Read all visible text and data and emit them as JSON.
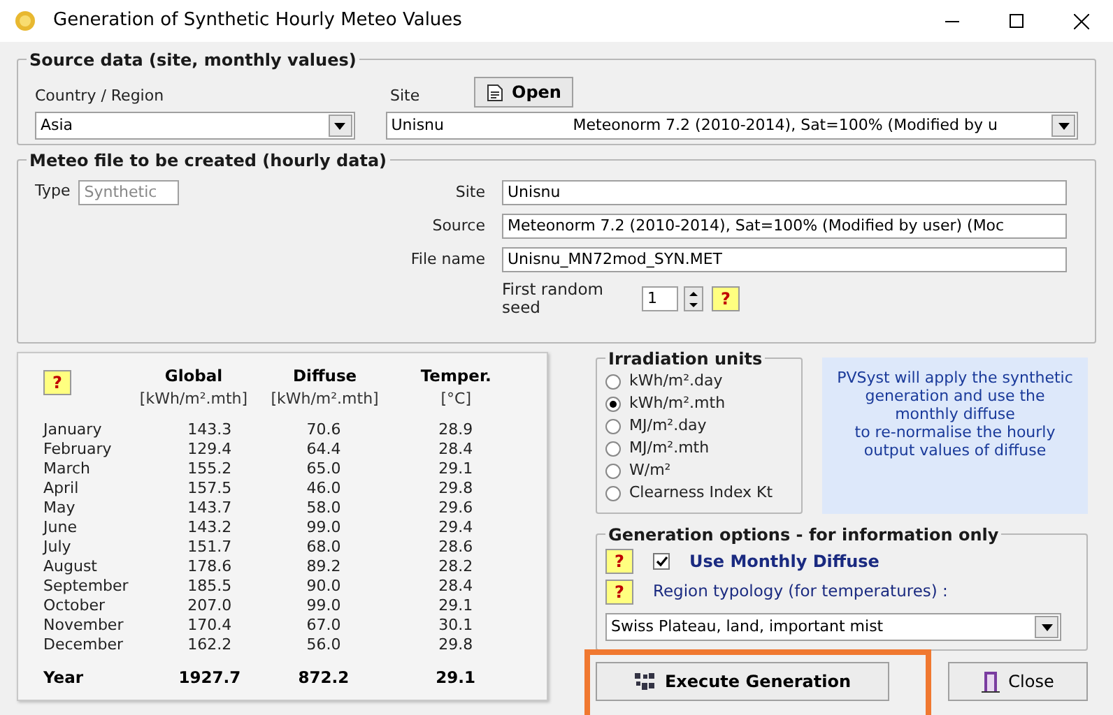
{
  "window": {
    "title": "Generation of Synthetic Hourly Meteo Values"
  },
  "source": {
    "title": "Source data  (site, monthly values)",
    "country_label": "Country / Region",
    "country_value": "Asia",
    "site_label": "Site",
    "open_button": "Open",
    "site_value": "Unisnu",
    "site_source": "Meteonorm 7.2 (2010-2014), Sat=100% (Modified by u"
  },
  "meteo": {
    "title": "Meteo file to be created (hourly data)",
    "type_label": "Type",
    "type_value": "Synthetic",
    "site_label": "Site",
    "site_value": "Unisnu",
    "source_label": "Source",
    "source_value": "Meteonorm 7.2 (2010-2014), Sat=100% (Modified by user) (Moc",
    "filename_label": "File name",
    "filename_value": "Unisnu_MN72mod_SYN.MET",
    "seed_label": "First random seed",
    "seed_value": "1",
    "help": "?"
  },
  "table": {
    "columns": [
      {
        "name": "Global",
        "unit": "[kWh/m².mth]"
      },
      {
        "name": "Diffuse",
        "unit": "[kWh/m².mth]"
      },
      {
        "name": "Temper.",
        "unit": "[°C]"
      }
    ],
    "rows": [
      {
        "month": "January",
        "values": [
          "143.3",
          "70.6",
          "28.9"
        ]
      },
      {
        "month": "February",
        "values": [
          "129.4",
          "64.4",
          "28.4"
        ]
      },
      {
        "month": "March",
        "values": [
          "155.2",
          "65.0",
          "29.1"
        ]
      },
      {
        "month": "April",
        "values": [
          "157.5",
          "46.0",
          "29.8"
        ]
      },
      {
        "month": "May",
        "values": [
          "143.7",
          "58.0",
          "29.6"
        ]
      },
      {
        "month": "June",
        "values": [
          "143.2",
          "99.0",
          "29.4"
        ]
      },
      {
        "month": "July",
        "values": [
          "151.7",
          "68.0",
          "28.6"
        ]
      },
      {
        "month": "August",
        "values": [
          "178.6",
          "89.2",
          "28.2"
        ]
      },
      {
        "month": "September",
        "values": [
          "185.5",
          "90.0",
          "28.4"
        ]
      },
      {
        "month": "October",
        "values": [
          "207.0",
          "99.0",
          "29.1"
        ]
      },
      {
        "month": "November",
        "values": [
          "170.4",
          "67.0",
          "30.1"
        ]
      },
      {
        "month": "December",
        "values": [
          "162.2",
          "56.0",
          "29.8"
        ]
      }
    ],
    "total": {
      "month": "Year",
      "values": [
        "1927.7",
        "872.2",
        "29.1"
      ]
    }
  },
  "units": {
    "title": "Irradiation units",
    "options": [
      {
        "label": "kWh/m².day",
        "selected": false
      },
      {
        "label": "kWh/m².mth",
        "selected": true
      },
      {
        "label": "MJ/m².day",
        "selected": false
      },
      {
        "label": "MJ/m².mth",
        "selected": false
      },
      {
        "label": "W/m²",
        "selected": false
      },
      {
        "label": "Clearness Index Kt",
        "selected": false
      }
    ]
  },
  "info": {
    "lines": [
      "PVSyst will apply the synthetic generation and use the monthly diffuse",
      "to re-normalise the hourly output values of diffuse"
    ]
  },
  "options": {
    "title": "Generation options - for information only",
    "help": "?",
    "diffuse": {
      "label": "Use Monthly Diffuse",
      "checked": true
    },
    "region_label": "Region typology (for temperatures) :",
    "region_value": "Swiss Plateau, land, important mist"
  },
  "buttons": {
    "execute": "Execute Generation",
    "close": "Close",
    "execute_highlighted": true
  }
}
